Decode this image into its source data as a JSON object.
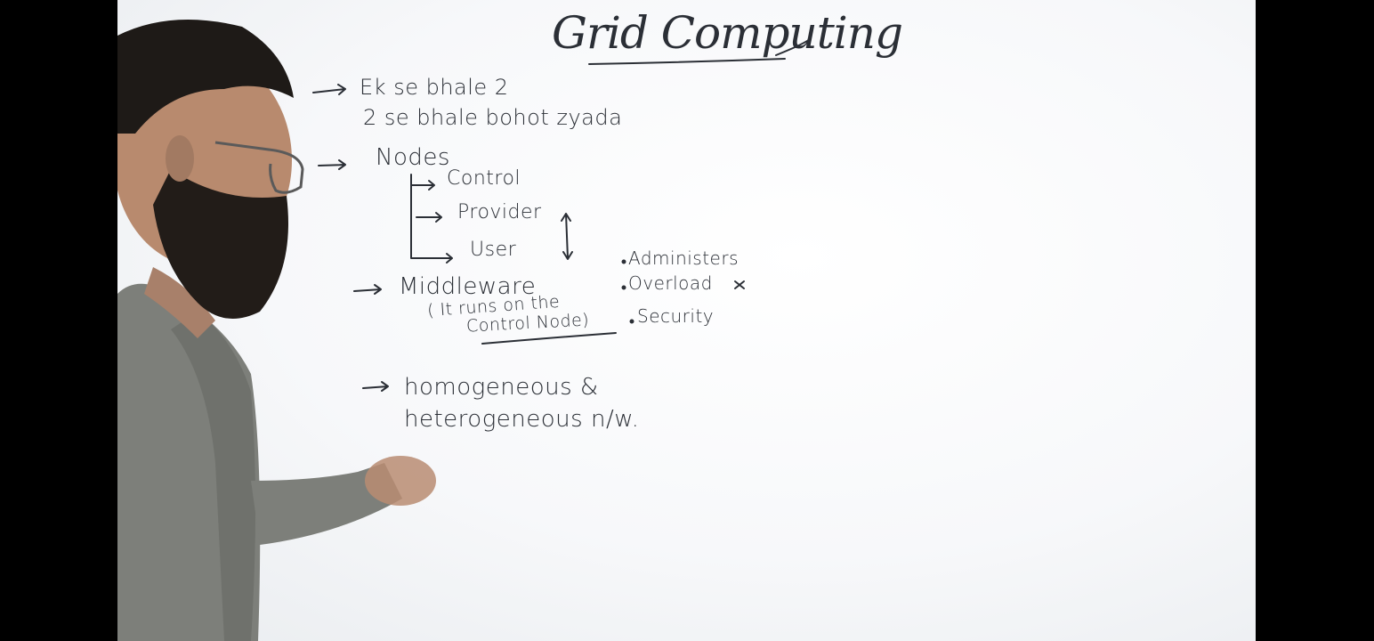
{
  "whiteboard": {
    "title": "Grid Computing",
    "line1": "Ek se bhale 2",
    "line2": "2 se bhale bohot zyada",
    "nodes": {
      "label": "Nodes",
      "items": [
        "Control",
        "Provider",
        "User"
      ]
    },
    "middleware": {
      "label": "Middleware",
      "note_line1": "( It runs on the",
      "note_line2": "Control Node)"
    },
    "roles": [
      "Administers",
      "Overload",
      "Security"
    ],
    "network_line1": "homogeneous &",
    "network_line2": "heterogeneous n/w."
  },
  "colors": {
    "board": "#f7f8fa",
    "ink": "#2b2f36",
    "letterbox": "#000000",
    "shirt": "#7d7f7a",
    "skin": "#b88a6e",
    "hair": "#1e1a17"
  }
}
